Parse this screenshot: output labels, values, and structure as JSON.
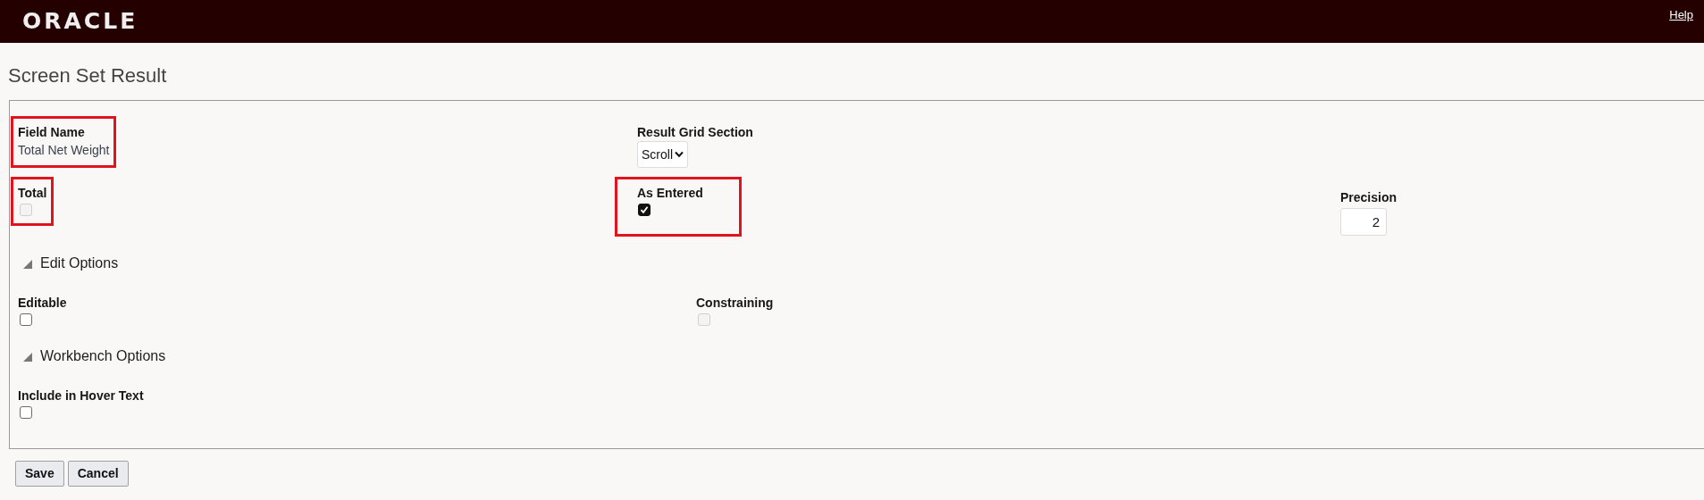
{
  "header": {
    "logo": "ORACLE",
    "help_link": "Help"
  },
  "page_title": "Screen Set Result",
  "field_name": {
    "label": "Field Name",
    "value": "Total Net Weight",
    "highlighted": true
  },
  "result_grid_section": {
    "label": "Result Grid Section",
    "value": "Scroll"
  },
  "total": {
    "label": "Total",
    "checked": false,
    "disabled": true,
    "highlighted": true
  },
  "as_entered": {
    "label": "As Entered",
    "checked": true,
    "disabled": false,
    "highlighted": true
  },
  "precision": {
    "label": "Precision",
    "value": "2"
  },
  "sections": [
    {
      "title": "Edit Options",
      "expanded": true,
      "fields": [
        {
          "label": "Editable",
          "checked": false,
          "disabled": false
        },
        {
          "label": "Constraining",
          "checked": false,
          "disabled": true
        }
      ]
    },
    {
      "title": "Workbench Options",
      "expanded": true,
      "fields": [
        {
          "label": "Include in Hover Text",
          "checked": false,
          "disabled": false
        }
      ]
    }
  ],
  "buttons": [
    "Save",
    "Cancel"
  ]
}
